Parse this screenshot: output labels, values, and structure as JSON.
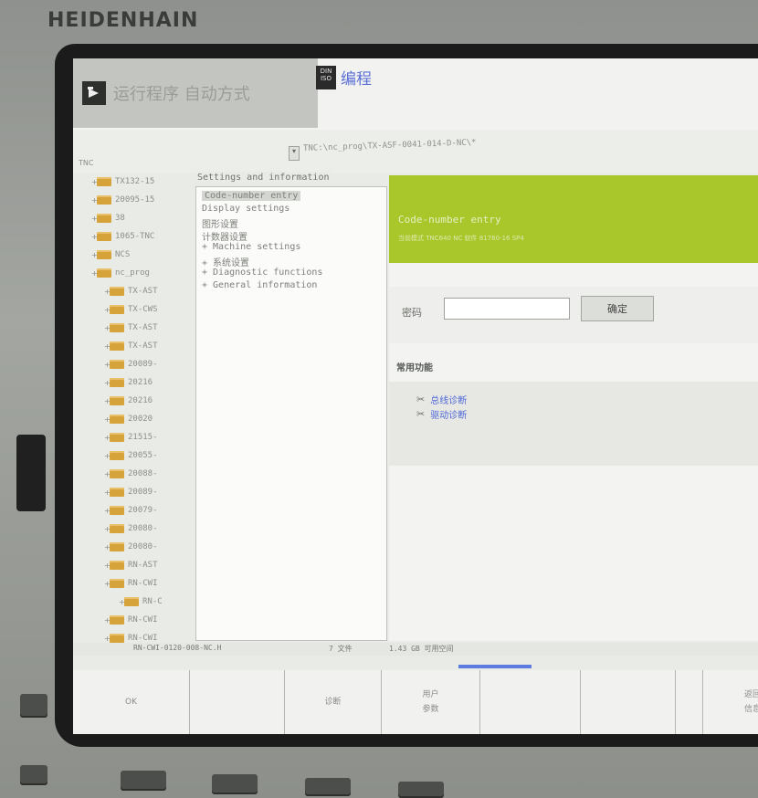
{
  "brand": "HEIDENHAIN",
  "modes": {
    "run_label": "运行程序 自动方式",
    "prog_icon_text": "DIN ISO",
    "prog_label": "编程"
  },
  "path": {
    "root": "TNC",
    "current": "TNC:\\nc_prog\\TX-ASF-0041-014-D-NC\\*"
  },
  "tree": [
    "TX132-15",
    "20095-15",
    "38",
    "1065-TNC",
    "NCS",
    "nc_prog",
    "TX-AST",
    "TX-CWS",
    "TX-AST",
    "TX-AST",
    "20089-",
    "20216",
    "20216",
    "20020",
    "21515-",
    "20055-",
    "20088-",
    "20089-",
    "20079-",
    "20080-",
    "20080-",
    "RN-AST",
    "RN-CWI",
    "RN-C",
    "RN-CWI",
    "RN-CWI"
  ],
  "settings": {
    "title": "Settings and information",
    "items": [
      "Code-number entry",
      "Display settings",
      "图形设置",
      "计数器设置",
      "+ Machine settings",
      "+ 系统设置",
      "+ Diagnostic functions",
      "+ General information"
    ]
  },
  "panel": {
    "header_title": "Code-number entry",
    "header_sub": "当前模式 TNC640     NC 软件 81760-16 SP4",
    "password_label": "密码",
    "password_value": "",
    "ok_button": "确定",
    "common_title": "常用功能",
    "links": [
      "总线诊断",
      "驱动诊断"
    ]
  },
  "status": {
    "file": "RN-CWI-0120-008-NC.H",
    "count": "7 文件",
    "space": "1.43 GB 可用空间"
  },
  "softkeys": [
    {
      "line1": "OK",
      "line2": ""
    },
    {
      "line1": "",
      "line2": ""
    },
    {
      "line1": "诊断",
      "line2": ""
    },
    {
      "line1": "用户",
      "line2": "参数"
    },
    {
      "line1": "",
      "line2": ""
    },
    {
      "line1": "",
      "line2": ""
    },
    {
      "line1": "",
      "line2": ""
    },
    {
      "line1": "返回",
      "line2": "信息"
    }
  ],
  "colors": {
    "header_green": "#a9c72a",
    "link_blue": "#4e66d8",
    "folder": "#d6a23a"
  }
}
